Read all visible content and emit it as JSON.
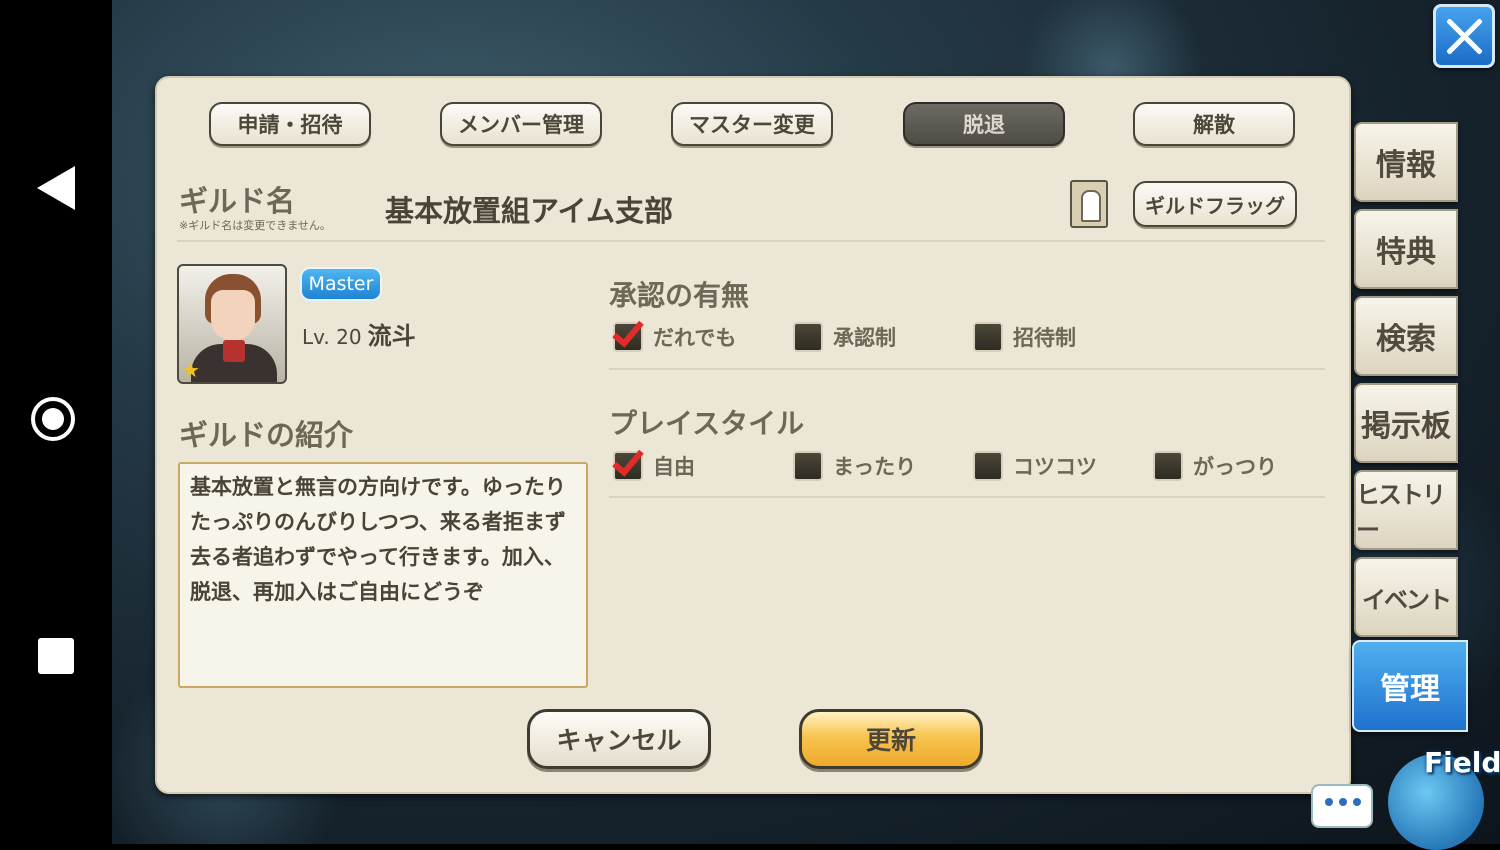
{
  "tabs": [
    "申請・招待",
    "メンバー管理",
    "マスター変更",
    "脱退",
    "解散"
  ],
  "active_tab_index": 3,
  "guild": {
    "name_label": "ギルド名",
    "name_note": "※ギルド名は変更できません。",
    "name": "基本放置組アイム支部",
    "flag_button": "ギルドフラッグ"
  },
  "member": {
    "rank": "Master",
    "level_label": "Lv. 20",
    "name": "流斗"
  },
  "intro": {
    "title": "ギルドの紹介",
    "text": "基本放置と無言の方向けです。ゆったりたっぷりのんびりしつつ、来る者拒まず去る者追わずでやって行きます。加入、脱退、再加入はご自由にどうぞ"
  },
  "approval": {
    "title": "承認の有無",
    "options": [
      {
        "label": "だれでも",
        "checked": true
      },
      {
        "label": "承認制",
        "checked": false
      },
      {
        "label": "招待制",
        "checked": false
      }
    ]
  },
  "playstyle": {
    "title": "プレイスタイル",
    "options": [
      {
        "label": "自由",
        "checked": true
      },
      {
        "label": "まったり",
        "checked": false
      },
      {
        "label": "コツコツ",
        "checked": false
      },
      {
        "label": "がっつり",
        "checked": false
      }
    ]
  },
  "actions": {
    "cancel": "キャンセル",
    "update": "更新"
  },
  "side_menu": [
    "情報",
    "特典",
    "検索",
    "掲示板",
    "ヒストリー",
    "イベント",
    "管理"
  ],
  "side_menu_active_index": 6,
  "field_label": "Field",
  "colors": {
    "panel": "#ebe6d6",
    "accent_blue": "#1e72cd",
    "update_gold": "#f7c450",
    "check_red": "#e12b2b"
  },
  "icons": [
    "back-icon",
    "home-icon",
    "recent-apps-icon",
    "close-icon",
    "guild-flag-icon",
    "star-icon",
    "chat-icon",
    "field-icon"
  ]
}
